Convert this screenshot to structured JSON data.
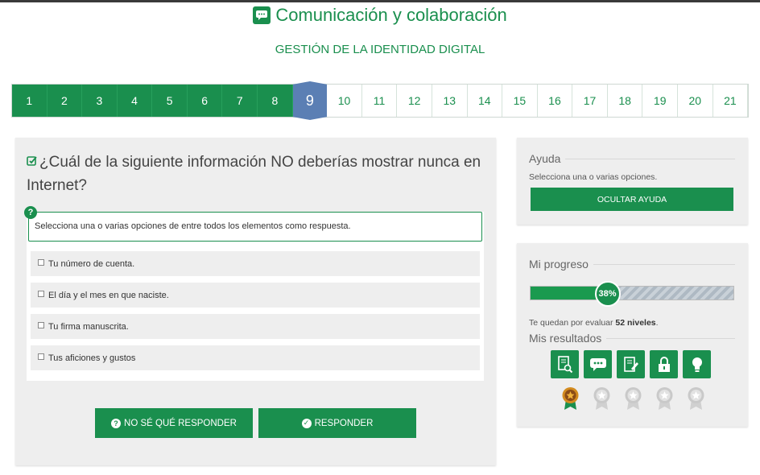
{
  "header": {
    "title": "Comunicación y colaboración",
    "icon": "chat-bubble-icon",
    "subtitle": "GESTIÓN DE LA IDENTIDAD DIGITAL"
  },
  "steps": {
    "items": [
      "1",
      "2",
      "3",
      "4",
      "5",
      "6",
      "7",
      "8",
      "9",
      "10",
      "11",
      "12",
      "13",
      "14",
      "15",
      "16",
      "17",
      "18",
      "19",
      "20",
      "21"
    ],
    "current": "9"
  },
  "question": {
    "text": "¿Cuál de la siguiente información NO deberías mostrar nunca en Internet?",
    "hint": "Selecciona una o varias opciones de entre todos los elementos como respuesta.",
    "options": [
      "Tu número de cuenta.",
      "El día y el mes en que naciste.",
      "Tu firma manuscrita.",
      "Tus aficiones y gustos"
    ],
    "dont_know_label": "NO SÉ QUÉ RESPONDER",
    "answer_label": "RESPONDER"
  },
  "help": {
    "title": "Ayuda",
    "text": "Selecciona una o varias opciones.",
    "hide_label": "OCULTAR AYUDA"
  },
  "progress": {
    "title": "Mi progreso",
    "percent_label": "38%",
    "percent": 38,
    "remaining_prefix": "Te quedan por evaluar",
    "remaining_value": "52 niveles",
    "remaining_suffix": "."
  },
  "results": {
    "title": "Mis resultados",
    "icons": [
      "document-search-icon",
      "chat-bubble-icon",
      "edit-document-icon",
      "lock-icon",
      "lightbulb-icon"
    ],
    "medals_earned": 1,
    "medals_total": 5
  },
  "colors": {
    "primary": "#1a8f4e",
    "current_step": "#5b7fb4",
    "panel": "#eeeeee"
  }
}
